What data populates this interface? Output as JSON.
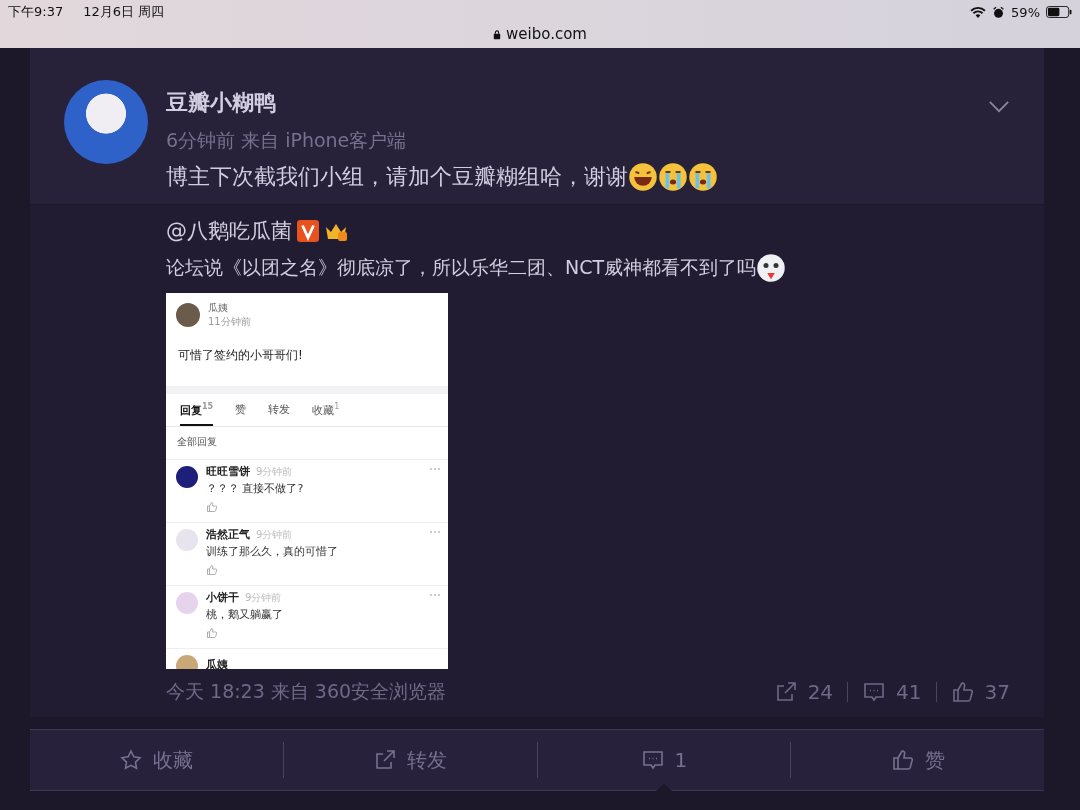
{
  "status_bar": {
    "time": "下午9:37",
    "date": "12月6日 周四",
    "url": "weibo.com",
    "battery": "59%"
  },
  "comment": {
    "username": "豆瓣小糊鸭",
    "meta": "6分钟前 来自 iPhone客户端",
    "text": "博主下次截我们小组，请加个豆瓣糊组哈，谢谢"
  },
  "repost": {
    "mention": "@八鹅吃瓜菌",
    "text": "论坛说《以团之名》彻底凉了，所以乐华二团、NCT威神都看不到了吗",
    "screenshot": {
      "author": "瓜姨",
      "time": "11分钟前",
      "text": "可惜了签约的小哥哥们!",
      "tabs": [
        {
          "label": "回复",
          "count": "15",
          "selected": true
        },
        {
          "label": "赞",
          "selected": false
        },
        {
          "label": "转发",
          "selected": false
        },
        {
          "label": "收藏",
          "count": "1",
          "selected": false
        }
      ],
      "section_label": "全部回复",
      "replies": [
        {
          "name": "旺旺雪饼",
          "time": "9分钟前",
          "text": "？？？ 直接不做了?",
          "color": "#1d1f7a"
        },
        {
          "name": "浩然正气",
          "time": "9分钟前",
          "text": "训练了那么久，真的可惜了",
          "color": "#e8e4ee"
        },
        {
          "name": "小饼干",
          "time": "9分钟前",
          "text": "桃，鹅又躺赢了",
          "color": "#e6d4ec"
        }
      ],
      "partial_name": "瓜姨"
    },
    "footer_meta": "今天 18:23 来自 360安全浏览器",
    "stats": [
      {
        "kind": "share",
        "count": "24"
      },
      {
        "kind": "comment",
        "count": "41"
      },
      {
        "kind": "like",
        "count": "37"
      }
    ]
  },
  "actions": [
    {
      "kind": "favorite",
      "label": "收藏",
      "selected": false
    },
    {
      "kind": "share",
      "label": "转发",
      "selected": false
    },
    {
      "kind": "comment",
      "label": "1",
      "selected": true
    },
    {
      "kind": "like",
      "label": "赞",
      "selected": false
    }
  ]
}
